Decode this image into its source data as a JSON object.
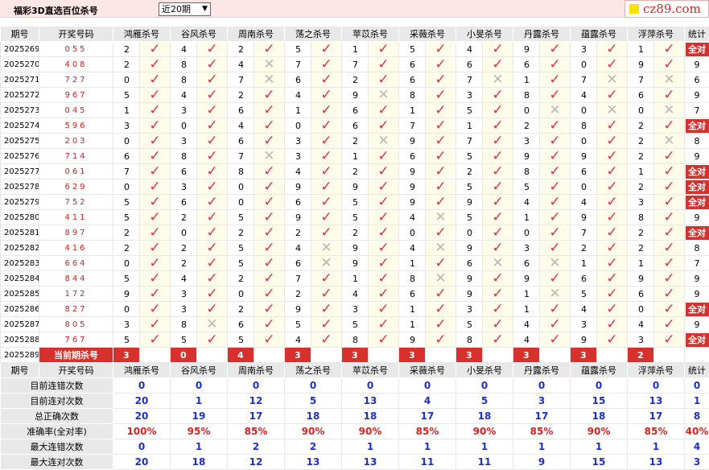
{
  "title": "福彩3D直选百位杀号",
  "period_select": "近20期",
  "logo": "cz89.com",
  "headers": [
    "期号",
    "开奖号码",
    "鸿雁杀号",
    "谷风杀号",
    "周南杀号",
    "荡之杀号",
    "苹苡杀号",
    "采薇杀号",
    "小旻杀号",
    "丹露杀号",
    "蕴露杀号",
    "浮萍杀号",
    "统计"
  ],
  "rows": [
    {
      "period": "2025269",
      "win": "055",
      "kills": [
        [
          "2",
          "ok"
        ],
        [
          "4",
          "ok"
        ],
        [
          "2",
          "ok"
        ],
        [
          "5",
          "ok"
        ],
        [
          "1",
          "ok"
        ],
        [
          "5",
          "ok"
        ],
        [
          "4",
          "ok"
        ],
        [
          "9",
          "ok"
        ],
        [
          "3",
          "ok"
        ],
        [
          "1",
          "ok"
        ]
      ],
      "stat": "全对"
    },
    {
      "period": "2025270",
      "win": "408",
      "kills": [
        [
          "2",
          "ok"
        ],
        [
          "8",
          "ok"
        ],
        [
          "4",
          "x"
        ],
        [
          "7",
          "ok"
        ],
        [
          "7",
          "ok"
        ],
        [
          "6",
          "ok"
        ],
        [
          "6",
          "ok"
        ],
        [
          "6",
          "ok"
        ],
        [
          "0",
          "ok"
        ],
        [
          "9",
          "ok"
        ]
      ],
      "stat": "9"
    },
    {
      "period": "2025271",
      "win": "727",
      "kills": [
        [
          "0",
          "ok"
        ],
        [
          "8",
          "ok"
        ],
        [
          "7",
          "x"
        ],
        [
          "6",
          "ok"
        ],
        [
          "2",
          "ok"
        ],
        [
          "6",
          "ok"
        ],
        [
          "7",
          "x"
        ],
        [
          "1",
          "ok"
        ],
        [
          "7",
          "x"
        ],
        [
          "7",
          "x"
        ]
      ],
      "stat": "6"
    },
    {
      "period": "2025272",
      "win": "967",
      "kills": [
        [
          "5",
          "ok"
        ],
        [
          "4",
          "ok"
        ],
        [
          "2",
          "ok"
        ],
        [
          "4",
          "ok"
        ],
        [
          "9",
          "x"
        ],
        [
          "8",
          "ok"
        ],
        [
          "3",
          "ok"
        ],
        [
          "8",
          "ok"
        ],
        [
          "4",
          "ok"
        ],
        [
          "6",
          "ok"
        ]
      ],
      "stat": "9"
    },
    {
      "period": "2025273",
      "win": "045",
      "kills": [
        [
          "1",
          "ok"
        ],
        [
          "3",
          "ok"
        ],
        [
          "6",
          "ok"
        ],
        [
          "1",
          "ok"
        ],
        [
          "6",
          "ok"
        ],
        [
          "1",
          "ok"
        ],
        [
          "5",
          "ok"
        ],
        [
          "0",
          "x"
        ],
        [
          "0",
          "x"
        ],
        [
          "0",
          "x"
        ]
      ],
      "stat": "7"
    },
    {
      "period": "2025274",
      "win": "596",
      "kills": [
        [
          "3",
          "ok"
        ],
        [
          "0",
          "ok"
        ],
        [
          "4",
          "ok"
        ],
        [
          "0",
          "ok"
        ],
        [
          "6",
          "ok"
        ],
        [
          "7",
          "ok"
        ],
        [
          "1",
          "ok"
        ],
        [
          "2",
          "ok"
        ],
        [
          "8",
          "ok"
        ],
        [
          "2",
          "ok"
        ]
      ],
      "stat": "全对"
    },
    {
      "period": "2025275",
      "win": "203",
      "kills": [
        [
          "0",
          "ok"
        ],
        [
          "3",
          "ok"
        ],
        [
          "6",
          "ok"
        ],
        [
          "3",
          "ok"
        ],
        [
          "2",
          "x"
        ],
        [
          "9",
          "ok"
        ],
        [
          "7",
          "ok"
        ],
        [
          "3",
          "ok"
        ],
        [
          "0",
          "ok"
        ],
        [
          "2",
          "x"
        ]
      ],
      "stat": "8"
    },
    {
      "period": "2025276",
      "win": "714",
      "kills": [
        [
          "6",
          "ok"
        ],
        [
          "8",
          "ok"
        ],
        [
          "7",
          "x"
        ],
        [
          "3",
          "ok"
        ],
        [
          "1",
          "ok"
        ],
        [
          "6",
          "ok"
        ],
        [
          "5",
          "ok"
        ],
        [
          "9",
          "ok"
        ],
        [
          "9",
          "ok"
        ],
        [
          "2",
          "ok"
        ]
      ],
      "stat": "9"
    },
    {
      "period": "2025277",
      "win": "061",
      "kills": [
        [
          "7",
          "ok"
        ],
        [
          "6",
          "ok"
        ],
        [
          "8",
          "ok"
        ],
        [
          "4",
          "ok"
        ],
        [
          "2",
          "ok"
        ],
        [
          "9",
          "ok"
        ],
        [
          "2",
          "ok"
        ],
        [
          "8",
          "ok"
        ],
        [
          "6",
          "ok"
        ],
        [
          "1",
          "ok"
        ]
      ],
      "stat": "全对"
    },
    {
      "period": "2025278",
      "win": "629",
      "kills": [
        [
          "0",
          "ok"
        ],
        [
          "3",
          "ok"
        ],
        [
          "0",
          "ok"
        ],
        [
          "9",
          "ok"
        ],
        [
          "9",
          "ok"
        ],
        [
          "9",
          "ok"
        ],
        [
          "5",
          "ok"
        ],
        [
          "5",
          "ok"
        ],
        [
          "0",
          "ok"
        ],
        [
          "2",
          "ok"
        ]
      ],
      "stat": "全对"
    },
    {
      "period": "2025279",
      "win": "752",
      "kills": [
        [
          "5",
          "ok"
        ],
        [
          "6",
          "ok"
        ],
        [
          "0",
          "ok"
        ],
        [
          "6",
          "ok"
        ],
        [
          "5",
          "ok"
        ],
        [
          "9",
          "ok"
        ],
        [
          "9",
          "ok"
        ],
        [
          "4",
          "ok"
        ],
        [
          "4",
          "ok"
        ],
        [
          "3",
          "ok"
        ]
      ],
      "stat": "全对"
    },
    {
      "period": "2025280",
      "win": "411",
      "kills": [
        [
          "5",
          "ok"
        ],
        [
          "2",
          "ok"
        ],
        [
          "5",
          "ok"
        ],
        [
          "9",
          "ok"
        ],
        [
          "5",
          "ok"
        ],
        [
          "4",
          "x"
        ],
        [
          "5",
          "ok"
        ],
        [
          "1",
          "ok"
        ],
        [
          "9",
          "ok"
        ],
        [
          "8",
          "ok"
        ]
      ],
      "stat": "9"
    },
    {
      "period": "2025281",
      "win": "897",
      "kills": [
        [
          "2",
          "ok"
        ],
        [
          "0",
          "ok"
        ],
        [
          "2",
          "ok"
        ],
        [
          "2",
          "ok"
        ],
        [
          "2",
          "ok"
        ],
        [
          "0",
          "ok"
        ],
        [
          "0",
          "ok"
        ],
        [
          "0",
          "ok"
        ],
        [
          "7",
          "ok"
        ],
        [
          "2",
          "ok"
        ]
      ],
      "stat": "全对"
    },
    {
      "period": "2025282",
      "win": "416",
      "kills": [
        [
          "2",
          "ok"
        ],
        [
          "2",
          "ok"
        ],
        [
          "5",
          "ok"
        ],
        [
          "4",
          "x"
        ],
        [
          "9",
          "ok"
        ],
        [
          "4",
          "x"
        ],
        [
          "9",
          "ok"
        ],
        [
          "3",
          "ok"
        ],
        [
          "2",
          "ok"
        ],
        [
          "2",
          "ok"
        ]
      ],
      "stat": "8"
    },
    {
      "period": "2025283",
      "win": "664",
      "kills": [
        [
          "0",
          "ok"
        ],
        [
          "2",
          "ok"
        ],
        [
          "5",
          "ok"
        ],
        [
          "6",
          "x"
        ],
        [
          "9",
          "ok"
        ],
        [
          "1",
          "ok"
        ],
        [
          "6",
          "x"
        ],
        [
          "6",
          "x"
        ],
        [
          "1",
          "ok"
        ],
        [
          "1",
          "ok"
        ]
      ],
      "stat": "7"
    },
    {
      "period": "2025284",
      "win": "844",
      "kills": [
        [
          "5",
          "ok"
        ],
        [
          "4",
          "ok"
        ],
        [
          "2",
          "ok"
        ],
        [
          "7",
          "ok"
        ],
        [
          "1",
          "ok"
        ],
        [
          "8",
          "x"
        ],
        [
          "9",
          "ok"
        ],
        [
          "9",
          "ok"
        ],
        [
          "6",
          "ok"
        ],
        [
          "9",
          "ok"
        ]
      ],
      "stat": "9"
    },
    {
      "period": "2025285",
      "win": "172",
      "kills": [
        [
          "9",
          "ok"
        ],
        [
          "3",
          "ok"
        ],
        [
          "0",
          "ok"
        ],
        [
          "2",
          "ok"
        ],
        [
          "4",
          "ok"
        ],
        [
          "6",
          "ok"
        ],
        [
          "9",
          "ok"
        ],
        [
          "1",
          "x"
        ],
        [
          "5",
          "ok"
        ],
        [
          "6",
          "ok"
        ]
      ],
      "stat": "9"
    },
    {
      "period": "2025286",
      "win": "827",
      "kills": [
        [
          "0",
          "ok"
        ],
        [
          "3",
          "ok"
        ],
        [
          "2",
          "ok"
        ],
        [
          "9",
          "ok"
        ],
        [
          "3",
          "ok"
        ],
        [
          "1",
          "ok"
        ],
        [
          "3",
          "ok"
        ],
        [
          "1",
          "ok"
        ],
        [
          "4",
          "ok"
        ],
        [
          "0",
          "ok"
        ]
      ],
      "stat": "全对"
    },
    {
      "period": "2025287",
      "win": "805",
      "kills": [
        [
          "3",
          "ok"
        ],
        [
          "8",
          "x"
        ],
        [
          "6",
          "ok"
        ],
        [
          "5",
          "ok"
        ],
        [
          "5",
          "ok"
        ],
        [
          "1",
          "ok"
        ],
        [
          "5",
          "ok"
        ],
        [
          "4",
          "ok"
        ],
        [
          "3",
          "ok"
        ],
        [
          "4",
          "ok"
        ]
      ],
      "stat": "9"
    },
    {
      "period": "2025288",
      "win": "767",
      "kills": [
        [
          "5",
          "ok"
        ],
        [
          "5",
          "ok"
        ],
        [
          "5",
          "ok"
        ],
        [
          "4",
          "ok"
        ],
        [
          "8",
          "ok"
        ],
        [
          "9",
          "ok"
        ],
        [
          "8",
          "ok"
        ],
        [
          "4",
          "ok"
        ],
        [
          "9",
          "ok"
        ],
        [
          "3",
          "ok"
        ]
      ],
      "stat": "全对"
    }
  ],
  "current": {
    "period": "2025289",
    "label": "当前期杀号",
    "kills": [
      "3",
      "0",
      "4",
      "3",
      "3",
      "3",
      "3",
      "3",
      "3",
      "2"
    ]
  },
  "stats": [
    {
      "label": "目前连错次数",
      "values": [
        "0",
        "0",
        "0",
        "0",
        "0",
        "0",
        "0",
        "0",
        "0",
        "0"
      ],
      "total": "0",
      "color": "b"
    },
    {
      "label": "目前连对次数",
      "values": [
        "20",
        "1",
        "12",
        "5",
        "13",
        "4",
        "5",
        "3",
        "15",
        "13"
      ],
      "total": "1",
      "color": "b"
    },
    {
      "label": "总正确次数",
      "values": [
        "20",
        "19",
        "17",
        "18",
        "18",
        "17",
        "18",
        "17",
        "18",
        "17"
      ],
      "total": "8",
      "color": "b"
    },
    {
      "label": "准确率(全对率)",
      "values": [
        "100%",
        "95%",
        "85%",
        "90%",
        "90%",
        "85%",
        "90%",
        "85%",
        "90%",
        "85%"
      ],
      "total": "40%",
      "color": "r"
    },
    {
      "label": "最大连错次数",
      "values": [
        "0",
        "1",
        "2",
        "2",
        "1",
        "1",
        "1",
        "1",
        "1",
        "1"
      ],
      "total": "4",
      "color": "b"
    },
    {
      "label": "最大连对次数",
      "values": [
        "20",
        "18",
        "12",
        "13",
        "13",
        "11",
        "11",
        "9",
        "15",
        "13"
      ],
      "total": "3",
      "color": "b"
    }
  ],
  "icons": {
    "ok": "checkmark-icon",
    "x": "cross-icon"
  },
  "colors": {
    "accent": "#d7312d",
    "blue": "#1a2fcc"
  }
}
